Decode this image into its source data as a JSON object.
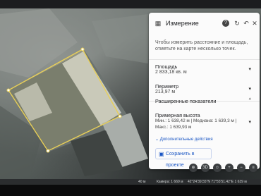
{
  "panel": {
    "title": "Измерение",
    "hint": "Чтобы измерить расстояние и площадь, отметьте на карте несколько точек.",
    "area_label": "Площадь",
    "area_value": "2 833,18 кв. м",
    "perimeter_label": "Периметр",
    "perimeter_value": "213,97 м",
    "advanced_label": "Расширенные показатели",
    "elevation_label": "Примерная высота",
    "elevation_minmed": "Мин.: 1 638,42 м | Медиана: 1 639,3 м |",
    "elevation_max": "Макс.: 1 639,93 м",
    "extra_actions": "Дополнительные действия",
    "save_label": "Сохранить в проекте"
  },
  "controls": {
    "tilt_label": "3D"
  },
  "status": {
    "scale": "40 м",
    "camera": "Камера: 1 669 м",
    "coords": "42°24'39.55\"N 71°55'51.42\"E 1 639 м"
  },
  "colors": {
    "outline": "#e8cf57",
    "accent": "#1a56c4"
  }
}
